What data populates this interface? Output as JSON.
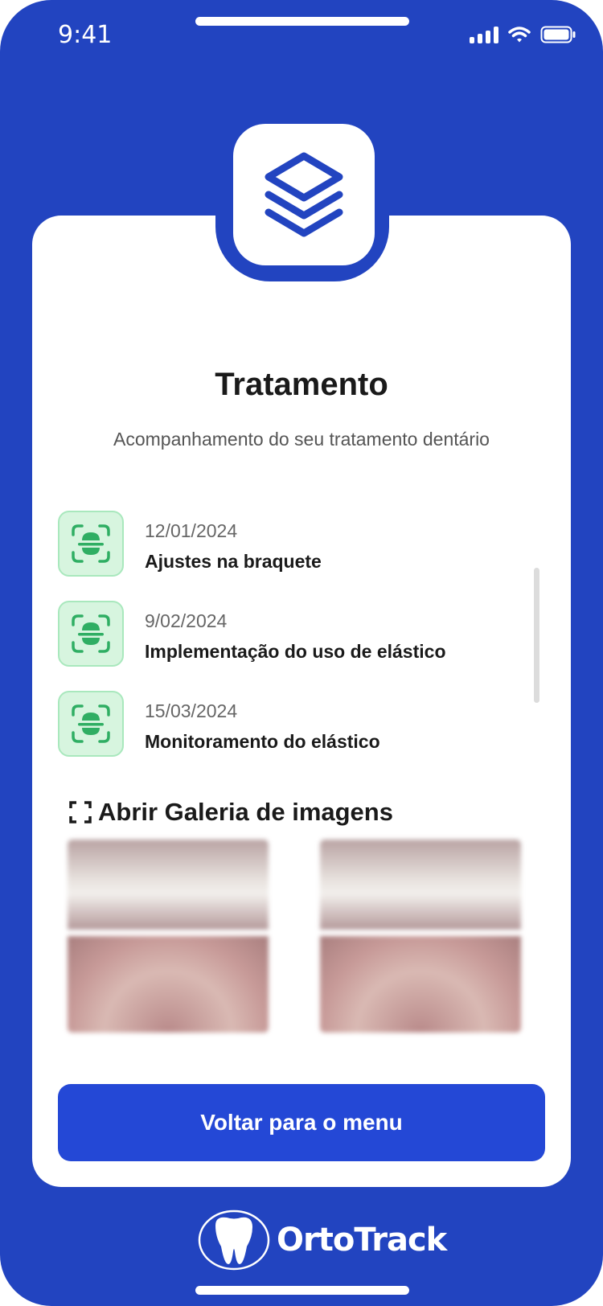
{
  "status_bar": {
    "time": "9:41"
  },
  "colors": {
    "brand_blue": "#2244c0",
    "button_blue": "#2448d6",
    "icon_green": "#2fae63",
    "icon_bg": "#d7f5df"
  },
  "header": {
    "logo_icon": "layers-icon",
    "title": "Tratamento",
    "subtitle": "Acompanhamento do seu tratamento dentário"
  },
  "treatment_list": {
    "items": [
      {
        "date": "12/01/2024",
        "description": "Ajustes na braquete",
        "icon": "scan-tooth-icon"
      },
      {
        "date": "9/02/2024",
        "description": "Implementação do uso de elástico",
        "icon": "scan-tooth-icon"
      },
      {
        "date": "15/03/2024",
        "description": "Monitoramento do elástico",
        "icon": "scan-tooth-icon"
      }
    ]
  },
  "gallery": {
    "link_label": "Abrir Galeria de imagens",
    "link_icon": "expand-icon"
  },
  "back_button": {
    "label": "Voltar para o menu"
  },
  "footer": {
    "brand_name": "OrtoTrack",
    "brand_icon": "tooth-logo-icon"
  }
}
